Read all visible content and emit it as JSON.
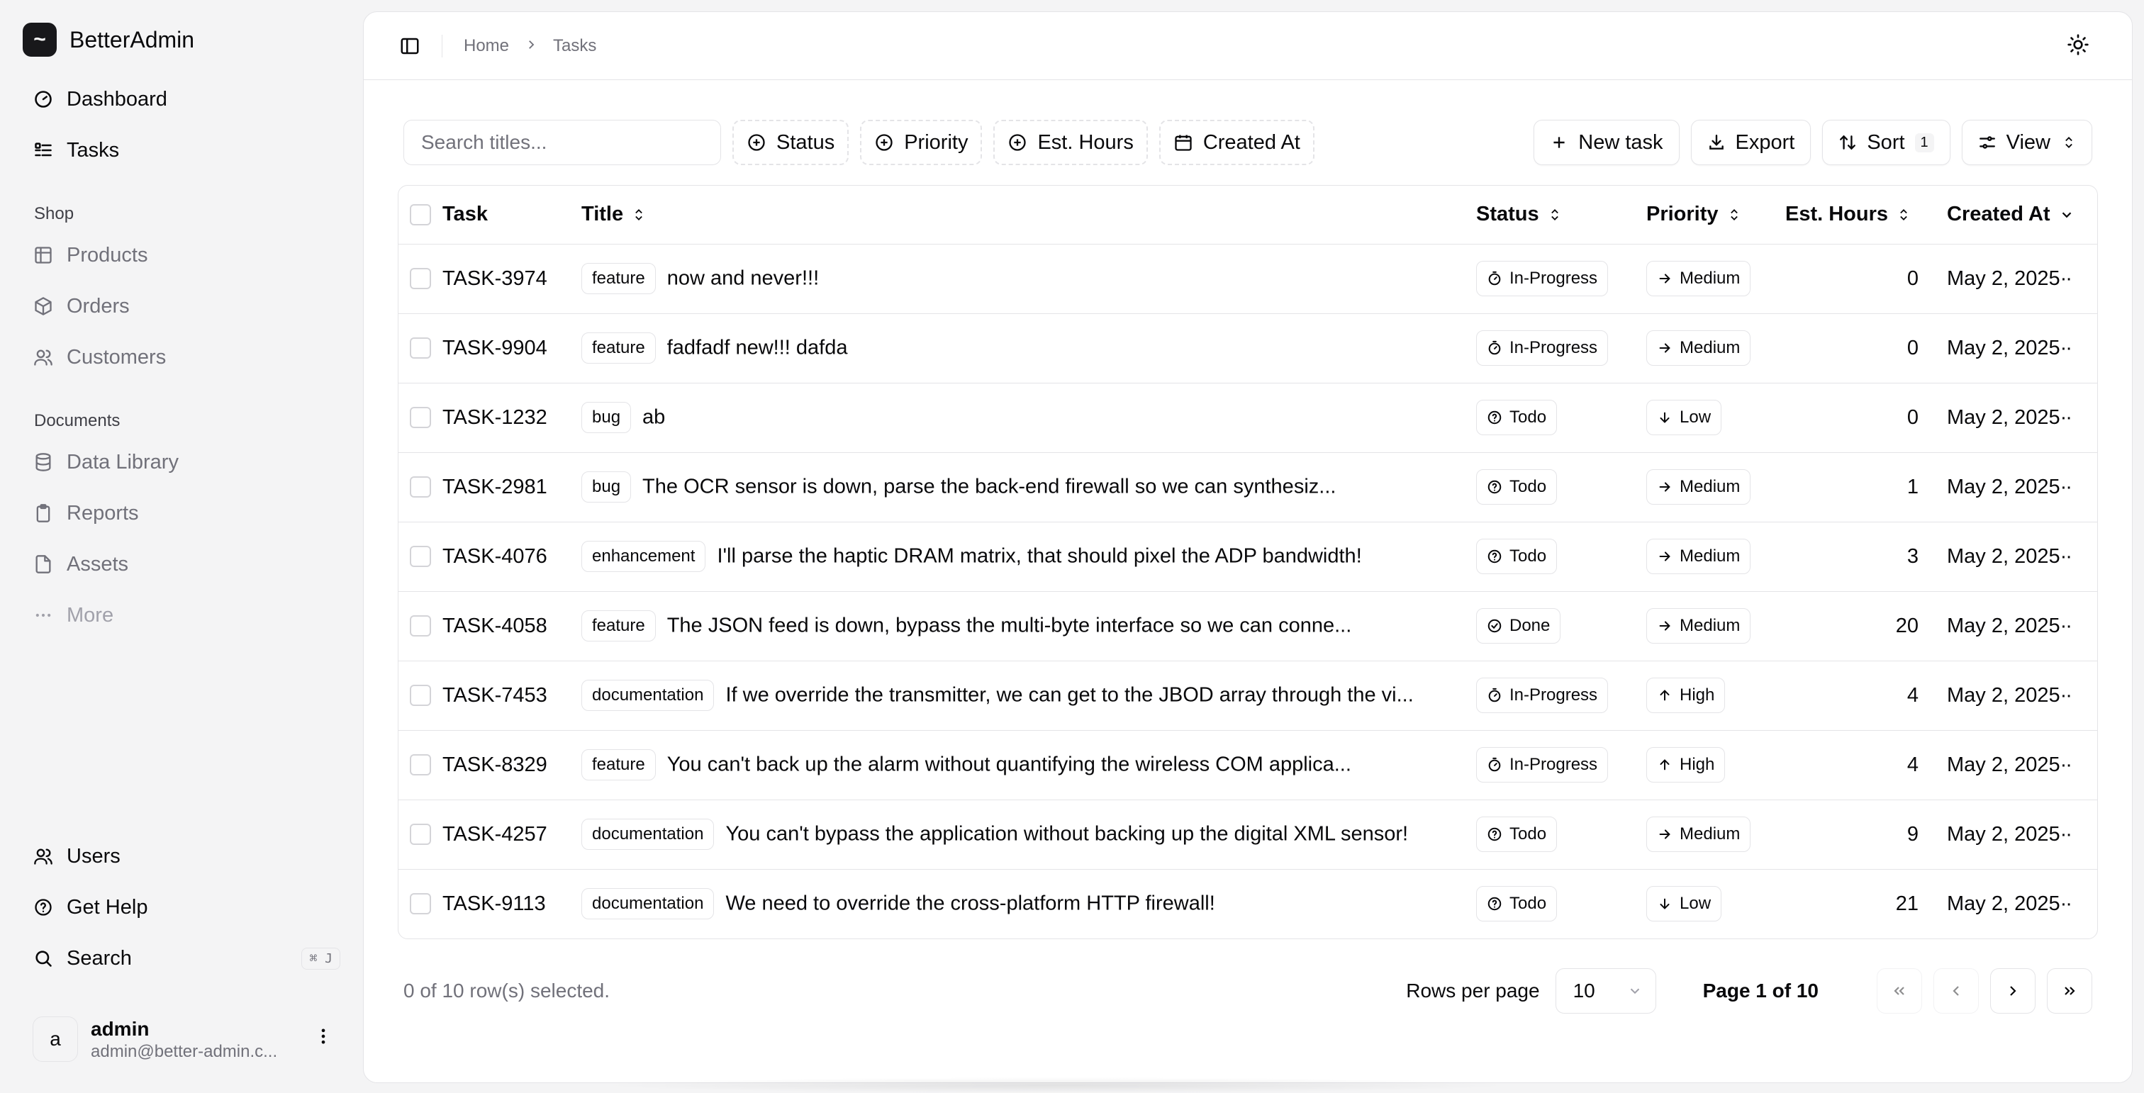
{
  "brand": {
    "logo": "~",
    "name": "BetterAdmin"
  },
  "sidebar": {
    "main_items": [
      {
        "label": "Dashboard",
        "icon": "gauge-icon"
      },
      {
        "label": "Tasks",
        "icon": "list-todo-icon"
      }
    ],
    "shop": {
      "label": "Shop",
      "items": [
        {
          "label": "Products",
          "icon": "grid-icon"
        },
        {
          "label": "Orders",
          "icon": "package-icon"
        },
        {
          "label": "Customers",
          "icon": "users-icon"
        }
      ]
    },
    "documents": {
      "label": "Documents",
      "items": [
        {
          "label": "Data Library",
          "icon": "database-icon"
        },
        {
          "label": "Reports",
          "icon": "clipboard-icon"
        },
        {
          "label": "Assets",
          "icon": "file-icon"
        },
        {
          "label": "More",
          "icon": "more-icon"
        }
      ]
    },
    "bottom_items": [
      {
        "label": "Users",
        "icon": "users-icon"
      },
      {
        "label": "Get Help",
        "icon": "help-circle-icon"
      },
      {
        "label": "Search",
        "icon": "search-icon",
        "shortcut": "⌘ J"
      }
    ],
    "user": {
      "initial": "a",
      "name": "admin",
      "email": "admin@better-admin.c..."
    }
  },
  "breadcrumb": {
    "home": "Home",
    "current": "Tasks"
  },
  "toolbar": {
    "search_placeholder": "Search titles...",
    "filters": [
      "Status",
      "Priority",
      "Est. Hours",
      "Created At"
    ],
    "new_task": "New task",
    "export": "Export",
    "sort": "Sort",
    "sort_count": "1",
    "view": "View"
  },
  "table": {
    "columns": {
      "task": "Task",
      "title": "Title",
      "status": "Status",
      "priority": "Priority",
      "hours": "Est. Hours",
      "created": "Created At"
    },
    "rows": [
      {
        "id": "TASK-3974",
        "label": "feature",
        "title": "now and never!!!",
        "status": "In-Progress",
        "priority": "Medium",
        "hours": "0",
        "created": "May 2, 2025"
      },
      {
        "id": "TASK-9904",
        "label": "feature",
        "title": "fadfadf new!!! dafda",
        "status": "In-Progress",
        "priority": "Medium",
        "hours": "0",
        "created": "May 2, 2025"
      },
      {
        "id": "TASK-1232",
        "label": "bug",
        "title": "ab",
        "status": "Todo",
        "priority": "Low",
        "hours": "0",
        "created": "May 2, 2025"
      },
      {
        "id": "TASK-2981",
        "label": "bug",
        "title": "The OCR sensor is down, parse the back-end firewall so we can synthesiz...",
        "status": "Todo",
        "priority": "Medium",
        "hours": "1",
        "created": "May 2, 2025"
      },
      {
        "id": "TASK-4076",
        "label": "enhancement",
        "title": "I'll parse the haptic DRAM matrix, that should pixel the ADP bandwidth!",
        "status": "Todo",
        "priority": "Medium",
        "hours": "3",
        "created": "May 2, 2025"
      },
      {
        "id": "TASK-4058",
        "label": "feature",
        "title": "The JSON feed is down, bypass the multi-byte interface so we can conne...",
        "status": "Done",
        "priority": "Medium",
        "hours": "20",
        "created": "May 2, 2025"
      },
      {
        "id": "TASK-7453",
        "label": "documentation",
        "title": "If we override the transmitter, we can get to the JBOD array through the vi...",
        "status": "In-Progress",
        "priority": "High",
        "hours": "4",
        "created": "May 2, 2025"
      },
      {
        "id": "TASK-8329",
        "label": "feature",
        "title": "You can't back up the alarm without quantifying the wireless COM applica...",
        "status": "In-Progress",
        "priority": "High",
        "hours": "4",
        "created": "May 2, 2025"
      },
      {
        "id": "TASK-4257",
        "label": "documentation",
        "title": "You can't bypass the application without backing up the digital XML sensor!",
        "status": "Todo",
        "priority": "Medium",
        "hours": "9",
        "created": "May 2, 2025"
      },
      {
        "id": "TASK-9113",
        "label": "documentation",
        "title": "We need to override the cross-platform HTTP firewall!",
        "status": "Todo",
        "priority": "Low",
        "hours": "21",
        "created": "May 2, 2025"
      }
    ]
  },
  "footer": {
    "selected": "0 of 10 row(s) selected.",
    "rows_per_page_label": "Rows per page",
    "rows_per_page": "10",
    "page_info": "Page 1 of 10"
  },
  "colors": {
    "primary": "#18181b",
    "muted": "#71717a",
    "border": "#e4e4e7",
    "sidebar_bg": "#f4f4f5"
  }
}
